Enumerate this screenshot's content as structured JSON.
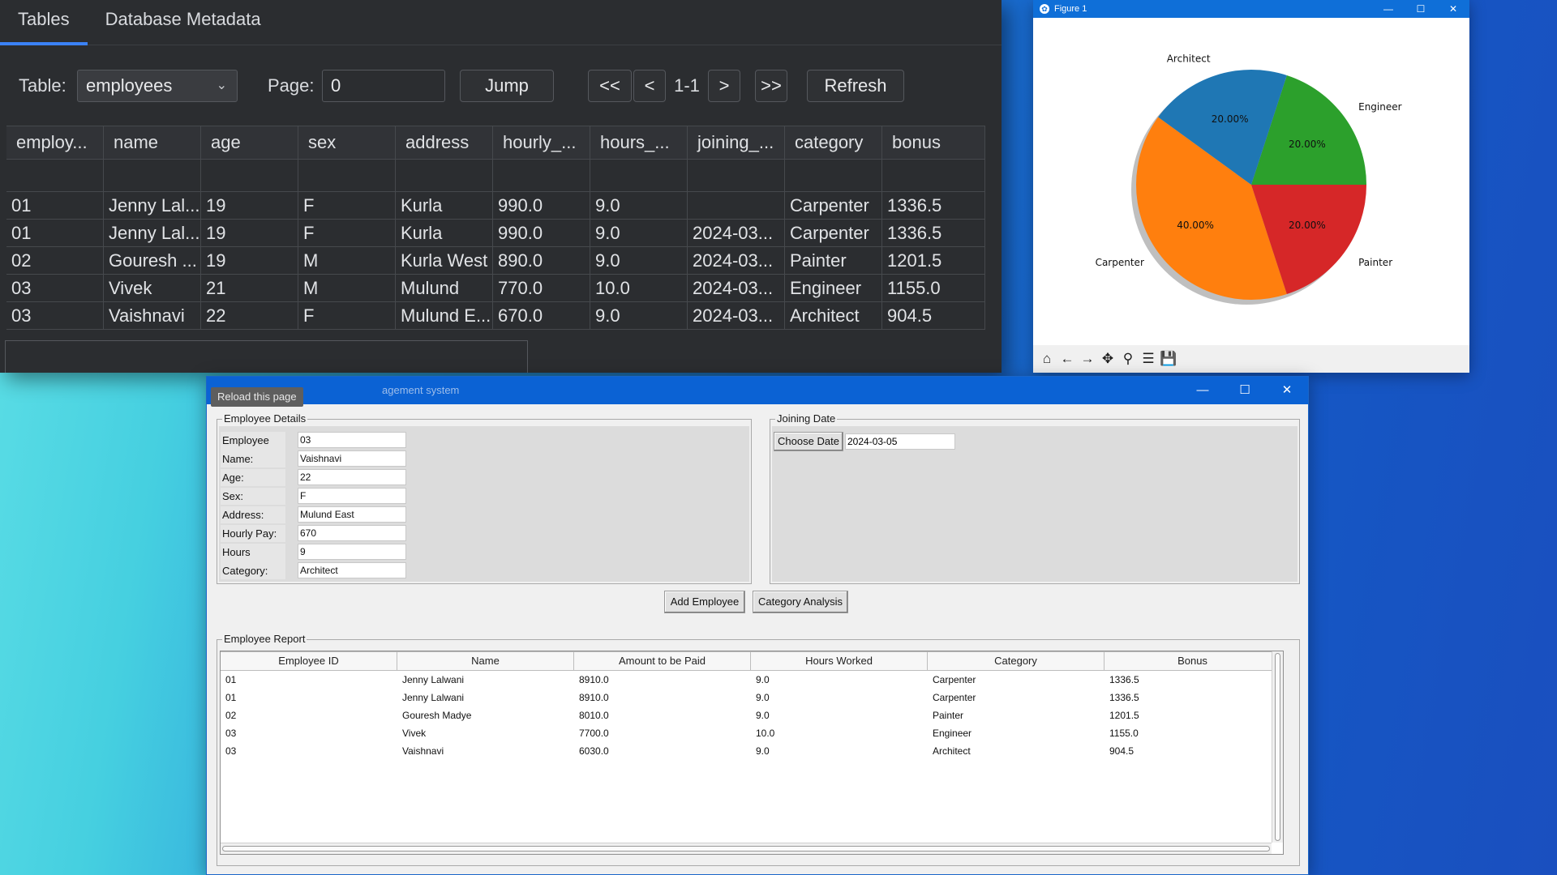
{
  "db_viewer": {
    "tabs": [
      {
        "label": "Tables"
      },
      {
        "label": "Database Metadata"
      }
    ],
    "table_label": "Table:",
    "table_value": "employees",
    "page_label": "Page:",
    "page_value": "0",
    "jump_label": "Jump",
    "first_label": "<<",
    "prev_label": "<",
    "page_range": "1-1",
    "next_label": ">",
    "last_label": ">>",
    "refresh_label": "Refresh",
    "columns": [
      "employ...",
      "name",
      "age",
      "sex",
      "address",
      "hourly_...",
      "hours_...",
      "joining_...",
      "category",
      "bonus"
    ],
    "rows": [
      [
        "01",
        "Jenny Lal...",
        "19",
        "F",
        "Kurla",
        "990.0",
        "9.0",
        "",
        "Carpenter",
        "1336.5"
      ],
      [
        "01",
        "Jenny Lal...",
        "19",
        "F",
        "Kurla",
        "990.0",
        "9.0",
        "2024-03...",
        "Carpenter",
        "1336.5"
      ],
      [
        "02",
        "Gouresh ...",
        "19",
        "M",
        "Kurla West",
        "890.0",
        "9.0",
        "2024-03...",
        "Painter",
        "1201.5"
      ],
      [
        "03",
        "Vivek",
        "21",
        "M",
        "Mulund",
        "770.0",
        "10.0",
        "2024-03...",
        "Engineer",
        "1155.0"
      ],
      [
        "03",
        "Vaishnavi",
        "22",
        "F",
        "Mulund E...",
        "670.0",
        "9.0",
        "2024-03...",
        "Architect",
        "904.5"
      ]
    ]
  },
  "figure": {
    "title": "Figure 1",
    "window_controls": [
      "—",
      "☐",
      "✕"
    ],
    "toolbar_icons": [
      "home-icon",
      "back-icon",
      "forward-icon",
      "pan-icon",
      "zoom-icon",
      "configure-icon",
      "save-icon"
    ],
    "toolbar_glyphs": [
      "⌂",
      "←",
      "→",
      "✥",
      "⚲",
      "☰",
      "💾"
    ]
  },
  "chart_data": {
    "type": "pie",
    "labels": [
      "Carpenter",
      "Painter",
      "Engineer",
      "Architect"
    ],
    "values": [
      40,
      20,
      20,
      20
    ],
    "display_labels": [
      "40.00%",
      "20.00%",
      "20.00%",
      "20.00%"
    ],
    "colors": [
      "#ff7f0e",
      "#d62728",
      "#2ca02c",
      "#1f77b4"
    ],
    "start_angle_deg": 144,
    "shadow": true
  },
  "app": {
    "reload_label": "Reload this page",
    "title_text": "agement system",
    "window_controls": [
      "—",
      "☐",
      "✕"
    ],
    "employee_details": {
      "title": "Employee Details",
      "fields": [
        {
          "label": "Employee ID:",
          "value": "03"
        },
        {
          "label": "Name:",
          "value": "Vaishnavi"
        },
        {
          "label": "Age:",
          "value": "22"
        },
        {
          "label": "Sex:",
          "value": "F"
        },
        {
          "label": "Address:",
          "value": "Mulund East"
        },
        {
          "label": "Hourly Pay:",
          "value": "670"
        },
        {
          "label": "Hours Worked:",
          "value": "9"
        },
        {
          "label": "Category:",
          "value": "Architect"
        }
      ]
    },
    "joining_date": {
      "title": "Joining Date",
      "button_label": "Choose Date",
      "value": "2024-03-05"
    },
    "add_employee_label": "Add Employee",
    "category_analysis_label": "Category Analysis",
    "report": {
      "title": "Employee Report",
      "columns": [
        "Employee ID",
        "Name",
        "Amount to be Paid",
        "Hours Worked",
        "Category",
        "Bonus"
      ],
      "rows": [
        [
          "01",
          "Jenny Lalwani",
          "8910.0",
          "9.0",
          "Carpenter",
          "1336.5"
        ],
        [
          "01",
          "Jenny Lalwani",
          "8910.0",
          "9.0",
          "Carpenter",
          "1336.5"
        ],
        [
          "02",
          "Gouresh Madye",
          "8010.0",
          "9.0",
          "Painter",
          "1201.5"
        ],
        [
          "03",
          "Vivek",
          "7700.0",
          "10.0",
          "Engineer",
          "1155.0"
        ],
        [
          "03",
          "Vaishnavi",
          "6030.0",
          "9.0",
          "Architect",
          "904.5"
        ]
      ]
    }
  }
}
